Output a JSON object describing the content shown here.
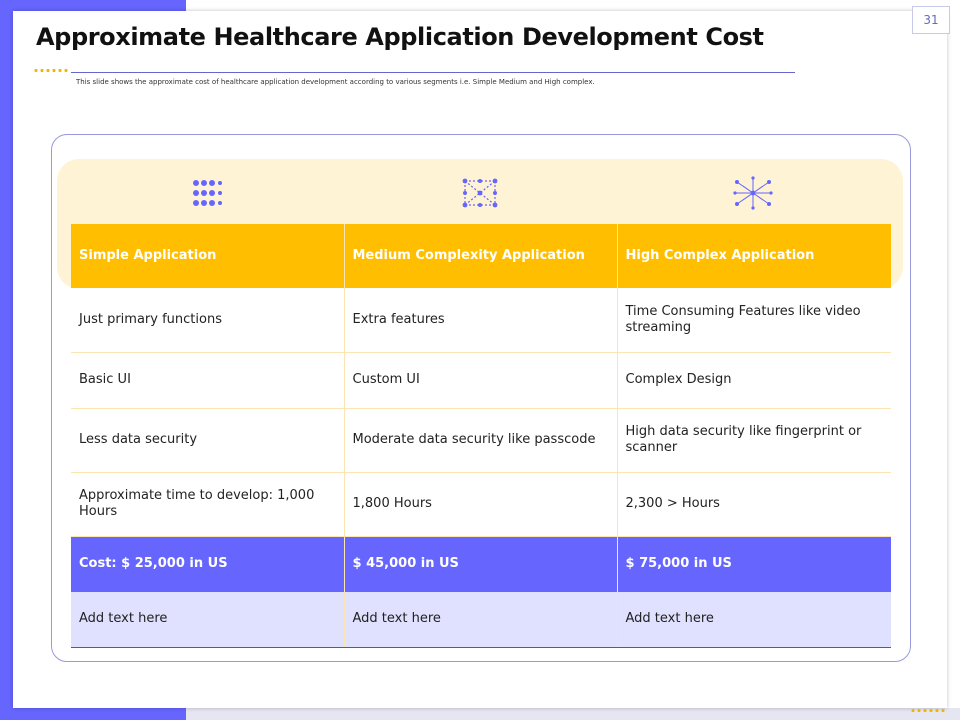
{
  "slide": {
    "page_number": "31",
    "title": "Approximate Healthcare Application Development Cost",
    "subtitle": "This slide shows the approximate cost of healthcare application development according to various segments i.e. Simple Medium and High complex."
  },
  "icons": [
    "dot-grid-icon",
    "network-grid-icon",
    "complex-network-icon"
  ],
  "colors": {
    "accent": "#6666ff",
    "header": "#ffbf00",
    "band": "#fff3d6",
    "light_row": "#e0e0ff"
  },
  "table": {
    "headers": [
      "Simple Application",
      "Medium Complexity Application",
      "High Complex Application"
    ],
    "rows": [
      [
        "Just primary functions",
        "Extra features",
        "Time Consuming Features like video streaming"
      ],
      [
        "Basic UI",
        "Custom UI",
        "Complex Design"
      ],
      [
        "Less data security",
        "Moderate data security like passcode",
        "High data security like fingerprint or scanner"
      ],
      [
        "Approximate time to develop: 1,000 Hours",
        "1,800 Hours",
        "2,300 > Hours"
      ]
    ],
    "cost_row": [
      "Cost: $ 25,000 in US",
      "$ 45,000 in US",
      "$ 75,000 in US"
    ],
    "add_row": [
      "Add text here",
      "Add text here",
      "Add text here"
    ]
  }
}
